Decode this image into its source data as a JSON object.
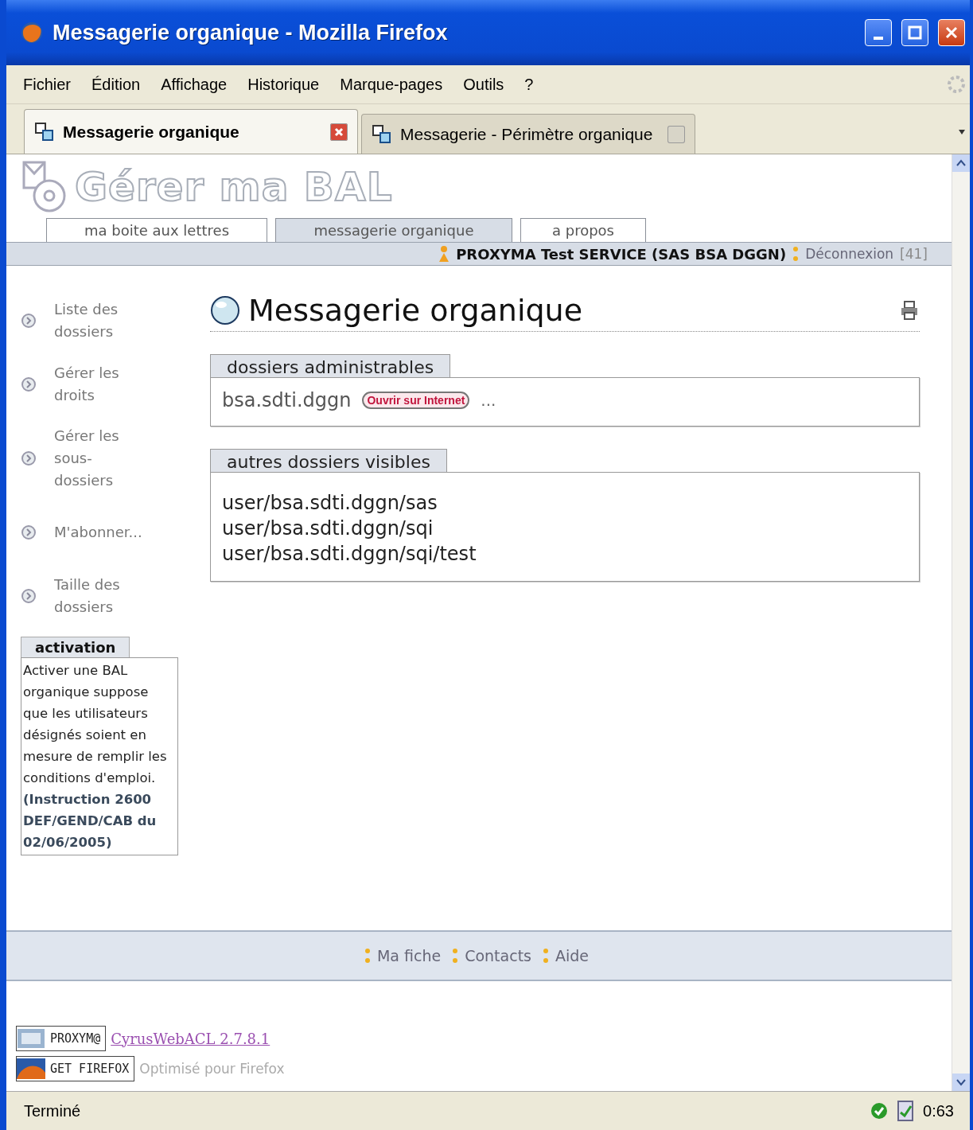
{
  "window": {
    "title": "Messagerie organique - Mozilla Firefox"
  },
  "menu": [
    "Fichier",
    "Édition",
    "Affichage",
    "Historique",
    "Marque-pages",
    "Outils",
    "?"
  ],
  "browser_tabs": [
    {
      "label": "Messagerie organique",
      "selected": true
    },
    {
      "label": "Messagerie - Périmètre organique",
      "selected": false
    }
  ],
  "site": {
    "logo_text": "Gérer ma BAL",
    "tabs": [
      {
        "label": "ma boite aux lettres",
        "selected": false
      },
      {
        "label": "messagerie organique",
        "selected": true
      },
      {
        "label": "a propos",
        "selected": false
      }
    ],
    "user": "PROXYMA Test SERVICE (SAS BSA DGGN)",
    "logout": "Déconnexion",
    "logout_count": "[41]"
  },
  "sidebar": {
    "items": [
      "Liste des dossiers",
      "Gérer les droits",
      "Gérer les sous-dossiers",
      "M'abonner...",
      "Taille des dossiers"
    ],
    "activation": {
      "title": "activation",
      "text": "Activer une BAL organique suppose que les utilisateurs désignés soient en mesure de remplir les conditions d'emploi. **(Instruction 2600 DEF/GEND/CAB du 02/06/2005)**"
    }
  },
  "main": {
    "title": "Messagerie organique",
    "sections": [
      {
        "kind": "admin",
        "title": "dossiers administrables",
        "folder": "bsa.sdti.dggn",
        "badge": "Ouvrir sur Internet",
        "more": "..."
      },
      {
        "kind": "list",
        "title": "autres dossiers visibles",
        "folders": [
          "user/bsa.sdti.dggn/sas",
          "user/bsa.sdti.dggn/sqi",
          "user/bsa.sdti.dggn/sqi/test"
        ]
      }
    ]
  },
  "footer": {
    "links": [
      "Ma fiche",
      "Contacts",
      "Aide"
    ],
    "badges": [
      {
        "label": "PROXYM@",
        "text": "CyrusWebACL 2.7.8.1",
        "kind": "link"
      },
      {
        "label": "GET FIREFOX",
        "text": "Optimisé pour Firefox",
        "kind": "note"
      }
    ]
  },
  "status_bar": {
    "text": "Terminé",
    "time": "0:63"
  }
}
